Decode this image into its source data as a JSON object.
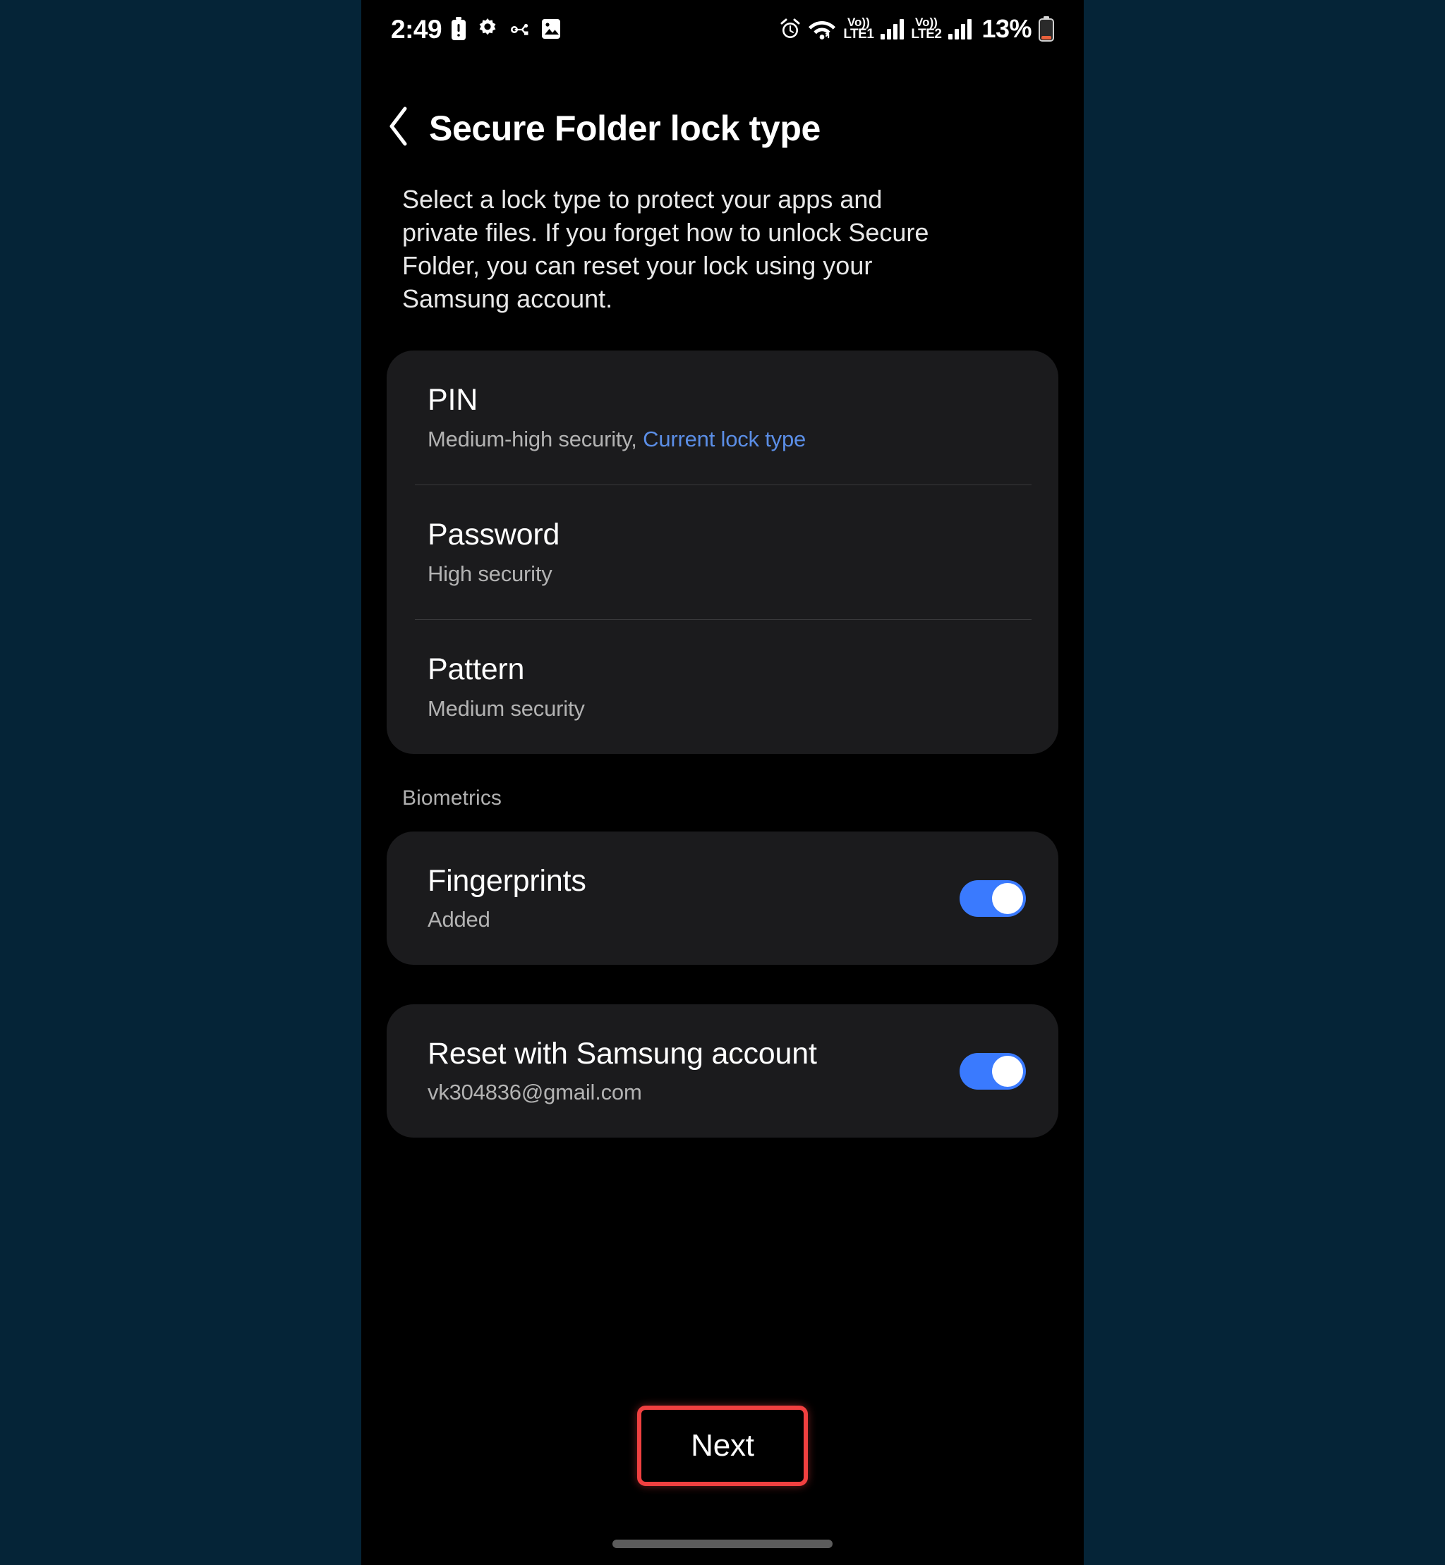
{
  "status_bar": {
    "time": "2:49",
    "left_icons": [
      "battery-saver-icon",
      "gear-icon",
      "usb-debugging-icon",
      "screenshot-icon"
    ],
    "right_icons": [
      "alarm-icon",
      "wifi-icon"
    ],
    "sim1_network": "VoLTE1",
    "sim1_label_top": "Vo))",
    "sim1_label_bottom": "LTE1",
    "sim2_label_top": "Vo))",
    "sim2_label_bottom": "LTE2",
    "battery_percent": "13%"
  },
  "header": {
    "back_icon": "chevron-left-icon",
    "title": "Secure Folder lock type"
  },
  "description": "Select a lock type to protect your apps and private files. If you forget how to unlock Secure Folder, you can reset your lock using your Samsung account.",
  "lock_options": [
    {
      "title": "PIN",
      "subtitle": "Medium-high security, ",
      "link": "Current lock type"
    },
    {
      "title": "Password",
      "subtitle": "High security",
      "link": ""
    },
    {
      "title": "Pattern",
      "subtitle": "Medium security",
      "link": ""
    }
  ],
  "biometrics": {
    "section_label": "Biometrics",
    "row": {
      "title": "Fingerprints",
      "subtitle": "Added",
      "toggle_state": "on"
    }
  },
  "reset_account": {
    "title": "Reset with Samsung account",
    "subtitle": "vk304836@gmail.com",
    "toggle_state": "on"
  },
  "footer": {
    "next_label": "Next"
  },
  "colors": {
    "page_background": "#052437",
    "screen_background": "#000000",
    "card_background": "#1b1b1d",
    "accent_toggle": "#3a7afe",
    "link_blue": "#5b8ee6",
    "highlight_red": "#f04040",
    "secondary_text": "#b3b3b3"
  }
}
